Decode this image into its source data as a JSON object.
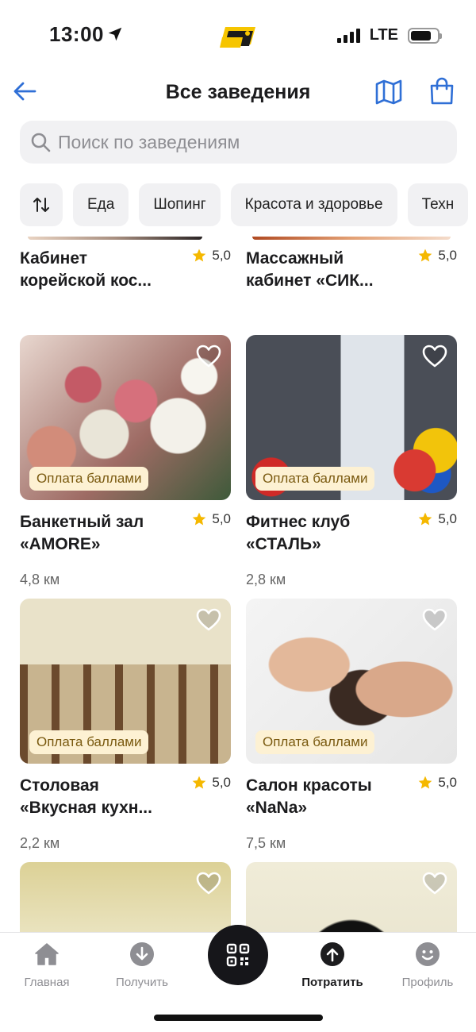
{
  "status_bar": {
    "time": "13:00",
    "network": "LTE"
  },
  "header": {
    "title": "Все заведения"
  },
  "search": {
    "placeholder": "Поиск по заведениям"
  },
  "filters": [
    "Еда",
    "Шопинг",
    "Красота и здоровье",
    "Техн"
  ],
  "badge_label": "Оплата баллами",
  "places": [
    {
      "name": "Кабинет\nкорейской кос...",
      "rating": "5,0",
      "distance": ""
    },
    {
      "name": "Массажный\nкабинет «СИК...",
      "rating": "5,0",
      "distance": ""
    },
    {
      "name": "Банкетный зал\n«AMORE»",
      "rating": "5,0",
      "distance": "4,8 км"
    },
    {
      "name": "Фитнес клуб\n«СТАЛЬ»",
      "rating": "5,0",
      "distance": "2,8 км"
    },
    {
      "name": "Столовая\n«Вкусная кухн...",
      "rating": "5,0",
      "distance": "2,2 км"
    },
    {
      "name": "Салон красоты\n«NaNa»",
      "rating": "5,0",
      "distance": "7,5 км"
    }
  ],
  "tabbar": {
    "home": "Главная",
    "receive": "Получить",
    "spend": "Потратить",
    "profile": "Профиль"
  },
  "colors": {
    "accent": "#2f6fd6",
    "badge_bg": "#fdf1d3",
    "star": "#f5b800",
    "chip_bg": "#f1f1f3"
  },
  "icons": [
    "location-arrow-icon",
    "app-logo",
    "back-arrow-icon",
    "map-icon",
    "shopping-bag-icon",
    "search-icon",
    "sort-icon",
    "heart-icon",
    "star-icon",
    "home-icon",
    "download-icon",
    "qr-code-icon",
    "upload-icon",
    "smile-icon"
  ]
}
